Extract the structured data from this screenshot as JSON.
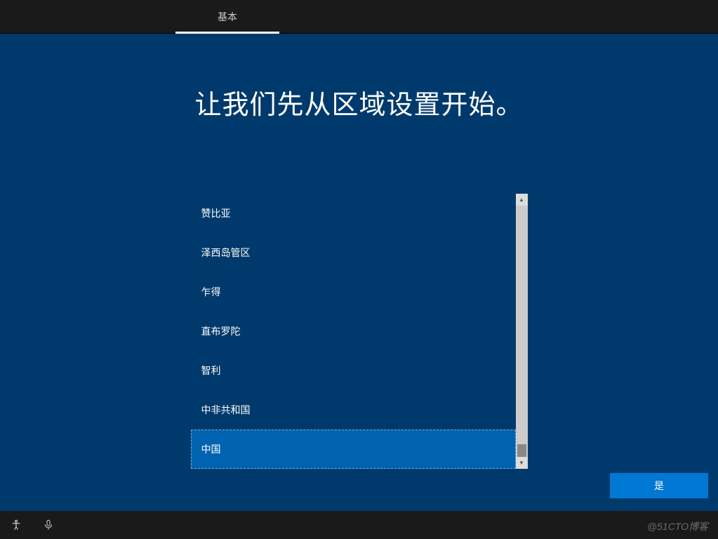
{
  "topbar": {
    "tab_label": "基本"
  },
  "main": {
    "title": "让我们先从区域设置开始。"
  },
  "regions": {
    "items": [
      {
        "label": "赞比亚",
        "selected": false
      },
      {
        "label": "泽西岛管区",
        "selected": false
      },
      {
        "label": "乍得",
        "selected": false
      },
      {
        "label": "直布罗陀",
        "selected": false
      },
      {
        "label": "智利",
        "selected": false
      },
      {
        "label": "中非共和国",
        "selected": false
      },
      {
        "label": "中国",
        "selected": true
      }
    ]
  },
  "actions": {
    "yes_label": "是"
  },
  "watermark": "@51CTO博客",
  "icons": {
    "accessibility": "accessibility-icon",
    "microphone": "microphone-icon",
    "scroll_up": "▲",
    "scroll_down": "▼"
  }
}
